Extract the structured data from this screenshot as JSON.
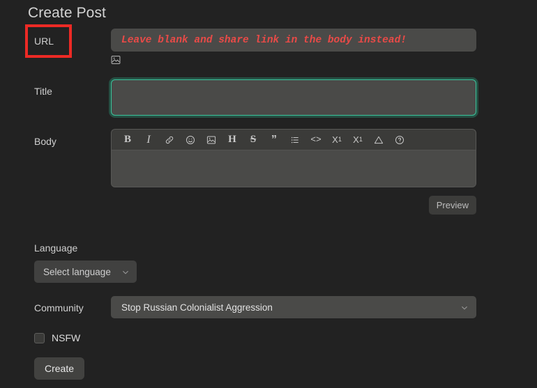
{
  "page": {
    "title": "Create Post"
  },
  "fields": {
    "url": {
      "label": "URL",
      "placeholder": "Leave blank and share link in the body instead!",
      "value": "",
      "annotation_color": "#ed2a25",
      "placeholder_color": "#e94a47",
      "image_upload_icon": "image-icon"
    },
    "title": {
      "label": "Title",
      "value": "",
      "placeholder": "",
      "focused": true,
      "focus_color": "#3cc49c"
    },
    "body": {
      "label": "Body",
      "value": "",
      "placeholder": "",
      "toolbar": [
        {
          "name": "bold-icon",
          "glyph": "B",
          "title": "Bold"
        },
        {
          "name": "italic-icon",
          "glyph": "I",
          "title": "Italic"
        },
        {
          "name": "link-icon",
          "glyph": "",
          "title": "Link"
        },
        {
          "name": "emoji-icon",
          "glyph": "",
          "title": "Emoji"
        },
        {
          "name": "image-icon",
          "glyph": "",
          "title": "Image"
        },
        {
          "name": "header-icon",
          "glyph": "H",
          "title": "Header"
        },
        {
          "name": "strikethrough-icon",
          "glyph": "S",
          "title": "Strikethrough"
        },
        {
          "name": "quote-icon",
          "glyph": "”",
          "title": "Quote"
        },
        {
          "name": "list-icon",
          "glyph": "",
          "title": "List"
        },
        {
          "name": "code-icon",
          "glyph": "<>",
          "title": "Code"
        },
        {
          "name": "subscript-icon",
          "glyph": "X",
          "title": "Subscript"
        },
        {
          "name": "superscript-icon",
          "glyph": "X",
          "title": "Superscript"
        },
        {
          "name": "spoiler-icon",
          "glyph": "",
          "title": "Spoiler"
        },
        {
          "name": "help-icon",
          "glyph": "",
          "title": "Formatting help"
        }
      ],
      "preview_label": "Preview"
    },
    "language": {
      "label": "Language",
      "value": "Select language"
    },
    "community": {
      "label": "Community",
      "value": "Stop Russian Colonialist Aggression"
    },
    "nsfw": {
      "label": "NSFW",
      "checked": false
    }
  },
  "actions": {
    "create_label": "Create"
  },
  "colors": {
    "page_background": "#222222",
    "input_background": "#4a4a48",
    "text": "#d8d8d8",
    "accent_focus": "#3cc49c",
    "annotation": "#ed2a25"
  }
}
